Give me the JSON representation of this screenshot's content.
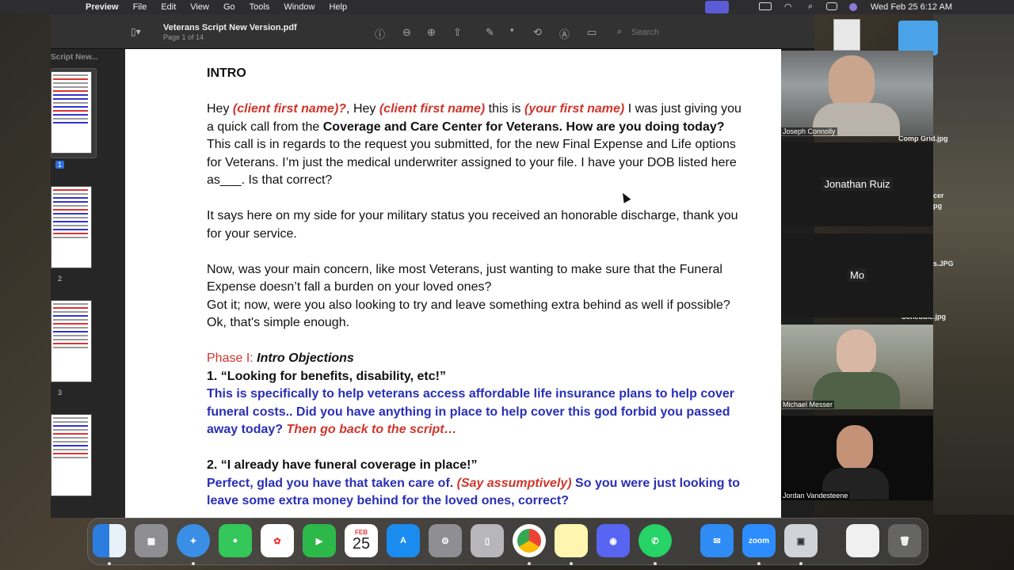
{
  "menubar": {
    "app": "Preview",
    "items": [
      "File",
      "Edit",
      "View",
      "Go",
      "Tools",
      "Window",
      "Help"
    ],
    "clock": "Wed Feb 25  6:12 AM"
  },
  "toolbar": {
    "title": "Veterans Script New Version.pdf",
    "subtitle": "Page 1 of 14",
    "search_placeholder": "Search"
  },
  "sidebar": {
    "title": "Script New...",
    "pages": [
      "1",
      "2",
      "3"
    ]
  },
  "doc": {
    "heading": "INTRO",
    "p1": {
      "t1": "Hey ",
      "r1": "(client first name)?",
      "t2": ", Hey ",
      "r2": "(client first name)",
      "t3": " this is ",
      "r3": "(your first name)",
      "t4": " I was just giving you a quick call from the ",
      "b1": "Coverage and Care Center for Veterans. How are you doing today?",
      "t5": " This call is in regards to the request you submitted, for the new Final Expense and Life options for Veterans. I’m just the medical underwriter assigned to your file. I have your DOB listed here as___. Is that correct?"
    },
    "p2": "It says here on my side for your military status you received an honorable discharge, thank you for your service.",
    "p3a": "Now, was your main concern, like most Veterans, just wanting to make sure that the Funeral Expense doesn’t fall a burden on your loved ones?",
    "p3b": "Got it; now, were you also looking to try and leave something extra behind as well if possible?",
    "p3c": "Ok, that's simple enough.",
    "phase_label": "Phase I: ",
    "phase_title": "Intro Objections",
    "obj1_title": "1. “Looking for benefits, disability, etc!”",
    "obj1_body": "This is specifically to help veterans access affordable life insurance plans to help cover funeral costs.. Did you have anything in place to help cover this god forbid you passed away today? ",
    "obj1_red": "Then go back to the script…",
    "obj2_title": "2. “I already have funeral coverage in place!”",
    "obj2_body1": "Perfect, glad you have that taken care of. ",
    "obj2_red": "(Say assumptively)",
    "obj2_body2": " So you were just looking to leave some extra money behind for the loved ones, correct?"
  },
  "zoom": {
    "participants": [
      "Joseph Connolly",
      "Jonathan Ruiz",
      "Mo",
      "Michael Messer",
      "Jordan Vandesteene"
    ]
  },
  "desktop_labels": [
    "Comp Grid.jpg",
    "cer",
    "pg",
    "s.JPG",
    "Schedule.jpg"
  ],
  "dock": {
    "calendar_month": "FEB",
    "calendar_day": "25",
    "zoom_label": "zoom"
  }
}
